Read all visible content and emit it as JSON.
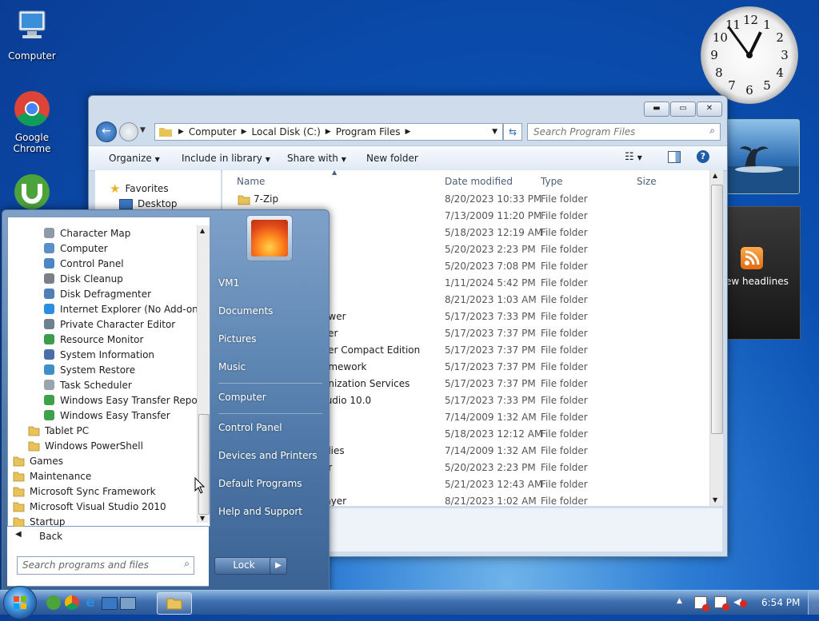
{
  "desktop": {
    "icons": [
      {
        "label": "Computer"
      },
      {
        "label": "Google Chrome"
      },
      {
        "label": "uTorrent"
      }
    ]
  },
  "clock_gadget": {
    "numerals": [
      "12",
      "1",
      "2",
      "3",
      "4",
      "5",
      "6",
      "7",
      "8",
      "9",
      "10",
      "11"
    ],
    "time": "6:54"
  },
  "feed_gadget": {
    "headline_text": "ew headlines"
  },
  "explorer": {
    "breadcrumb": [
      "Computer",
      "Local Disk (C:)",
      "Program Files"
    ],
    "search_placeholder": "Search Program Files",
    "toolbar": {
      "organize": "Organize",
      "include_in_library": "Include in library",
      "share_with": "Share with",
      "new_folder": "New folder"
    },
    "nav": {
      "favorites": "Favorites",
      "desktop": "Desktop"
    },
    "columns": {
      "name": "Name",
      "date_modified": "Date modified",
      "type": "Type",
      "size": "Size"
    },
    "rows": [
      {
        "name": "7-Zip",
        "date": "8/20/2023 10:33 PM",
        "type": "File folder"
      },
      {
        "name": "",
        "date": "7/13/2009 11:20 PM",
        "type": "File folder"
      },
      {
        "name": "",
        "date": "5/18/2023 12:19 AM",
        "type": "File folder"
      },
      {
        "name": "",
        "date": "5/20/2023 2:23 PM",
        "type": "File folder"
      },
      {
        "name": "",
        "date": "5/20/2023 7:08 PM",
        "type": "File folder"
      },
      {
        "name": "",
        "date": "1/11/2024 5:42 PM",
        "type": "File folder"
      },
      {
        "name": "",
        "date": "8/21/2023 1:03 AM",
        "type": "File folder"
      },
      {
        "name": "ewer",
        "date": "5/17/2023 7:33 PM",
        "type": "File folder"
      },
      {
        "name": "ver",
        "date": "5/17/2023 7:37 PM",
        "type": "File folder"
      },
      {
        "name": "ver Compact Edition",
        "date": "5/17/2023 7:37 PM",
        "type": "File folder"
      },
      {
        "name": "amework",
        "date": "5/17/2023 7:37 PM",
        "type": "File folder"
      },
      {
        "name": "onization Services",
        "date": "5/17/2023 7:37 PM",
        "type": "File folder"
      },
      {
        "name": "tudio 10.0",
        "date": "5/17/2023 7:33 PM",
        "type": "File folder"
      },
      {
        "name": "",
        "date": "7/14/2009 1:32 AM",
        "type": "File folder"
      },
      {
        "name": "",
        "date": "5/18/2023 12:12 AM",
        "type": "File folder"
      },
      {
        "name": "olies",
        "date": "7/14/2009 1:32 AM",
        "type": "File folder"
      },
      {
        "name": "er",
        "date": "5/20/2023 2:23 PM",
        "type": "File folder"
      },
      {
        "name": "",
        "date": "5/21/2023 12:43 AM",
        "type": "File folder"
      },
      {
        "name": "layer",
        "date": "8/21/2023 1:02 AM",
        "type": "File folder"
      }
    ]
  },
  "start_menu": {
    "programs": [
      {
        "label": "Character Map",
        "indent": 2,
        "icon": "charmap-icon"
      },
      {
        "label": "Computer",
        "indent": 2,
        "icon": "computer-icon"
      },
      {
        "label": "Control Panel",
        "indent": 2,
        "icon": "control-panel-icon"
      },
      {
        "label": "Disk Cleanup",
        "indent": 2,
        "icon": "disk-cleanup-icon"
      },
      {
        "label": "Disk Defragmenter",
        "indent": 2,
        "icon": "defrag-icon"
      },
      {
        "label": "Internet Explorer (No Add-ons)",
        "indent": 2,
        "icon": "ie-icon"
      },
      {
        "label": "Private Character Editor",
        "indent": 2,
        "icon": "char-editor-icon"
      },
      {
        "label": "Resource Monitor",
        "indent": 2,
        "icon": "resource-monitor-icon"
      },
      {
        "label": "System Information",
        "indent": 2,
        "icon": "system-info-icon"
      },
      {
        "label": "System Restore",
        "indent": 2,
        "icon": "system-restore-icon"
      },
      {
        "label": "Task Scheduler",
        "indent": 2,
        "icon": "task-scheduler-icon"
      },
      {
        "label": "Windows Easy Transfer Reports",
        "indent": 2,
        "icon": "easy-transfer-icon"
      },
      {
        "label": "Windows Easy Transfer",
        "indent": 2,
        "icon": "easy-transfer-icon"
      },
      {
        "label": "Tablet PC",
        "indent": 1,
        "icon": "folder-icon"
      },
      {
        "label": "Windows PowerShell",
        "indent": 1,
        "icon": "folder-icon"
      },
      {
        "label": "Games",
        "indent": 0,
        "icon": "folder-icon"
      },
      {
        "label": "Maintenance",
        "indent": 0,
        "icon": "folder-icon"
      },
      {
        "label": "Microsoft Sync Framework",
        "indent": 0,
        "icon": "folder-icon"
      },
      {
        "label": "Microsoft Visual Studio 2010",
        "indent": 0,
        "icon": "folder-icon"
      },
      {
        "label": "Startup",
        "indent": 0,
        "icon": "folder-icon"
      }
    ],
    "back": "Back",
    "search_placeholder": "Search programs and files",
    "right": {
      "user": "VM1",
      "documents": "Documents",
      "pictures": "Pictures",
      "music": "Music",
      "computer": "Computer",
      "control_panel": "Control Panel",
      "devices_printers": "Devices and Printers",
      "default_programs": "Default Programs",
      "help_support": "Help and Support"
    },
    "lock": "Lock"
  },
  "taskbar": {
    "time": "6:54 PM"
  },
  "colors": {
    "folder": "#e8c35a",
    "accent": "#2a5796"
  }
}
